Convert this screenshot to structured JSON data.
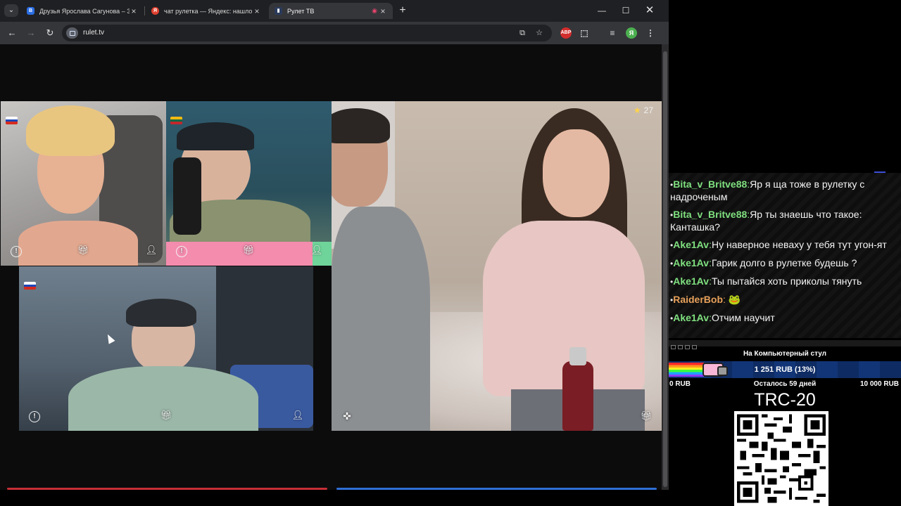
{
  "browser": {
    "tabs": [
      {
        "title": "Друзья Ярослава Сагунова – З",
        "favicon": "vk",
        "favicon_color": "#2b6ee4",
        "active": false
      },
      {
        "title": "чат рулетка — Яндекс: нашло",
        "favicon": "yandex",
        "favicon_color": "#e0402f",
        "active": false
      },
      {
        "title": "Рулет ТВ",
        "favicon": "rulet",
        "favicon_color": "#2a3b5c",
        "active": true
      }
    ],
    "url": "rulet.tv"
  },
  "video": {
    "star_count": "27",
    "tiles": [
      {
        "name": "top-left",
        "flag": "russia"
      },
      {
        "name": "top-middle",
        "flag": "lithuania"
      },
      {
        "name": "bottom-left",
        "flag": "russia"
      },
      {
        "name": "main",
        "flag": ""
      }
    ]
  },
  "chat": {
    "messages": [
      {
        "user": "Bita_v_Britve88",
        "color": "#7fe07f",
        "text": "Яр я ща тоже в рулетку с надроченым"
      },
      {
        "user": "Bita_v_Britve88",
        "color": "#7fe07f",
        "text": "Яр ты знаешь что такое: Канташка?"
      },
      {
        "user": "Ake1Av",
        "color": "#7fe07f",
        "text": "Ну наверное неваху у тебя тут угон-ят"
      },
      {
        "user": "Ake1Av",
        "color": "#7fe07f",
        "text": "Гарик долго в рулетке будешь ?"
      },
      {
        "user": "Ake1Av",
        "color": "#7fe07f",
        "text": "Ты пытайся хоть приколы тянуть"
      },
      {
        "user": "RaiderBob",
        "color": "#e8a15a",
        "text": "🐸"
      },
      {
        "user": "Ake1Av",
        "color": "#7fe07f",
        "text": "Отчим научит"
      }
    ]
  },
  "donation_goal": {
    "title": "На Компьютерный стул",
    "current": "1 251 RUB (13%)",
    "progress_fraction": 0.13,
    "min": "0 RUB",
    "remaining": "Осталось 59 дней",
    "max": "10 000 RUB"
  },
  "crypto": {
    "label": "TRC-20"
  }
}
